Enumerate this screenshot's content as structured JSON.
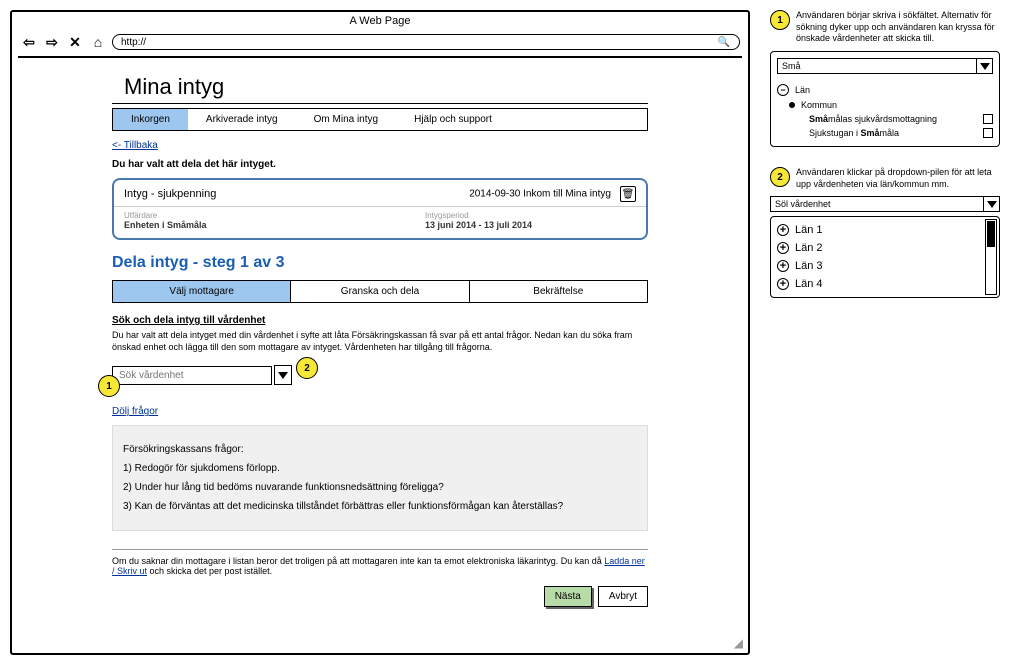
{
  "browser": {
    "title": "A Web Page",
    "url": "http://"
  },
  "page": {
    "title": "Mina intyg",
    "tabs": [
      "Inkorgen",
      "Arkiverade intyg",
      "Om Mina intyg",
      "Hjälp och support"
    ],
    "back_link": "<- Tillbaka",
    "intro": "Du har valt att dela det här intyget.",
    "cert": {
      "title": "Intyg - sjukpenning",
      "date": "2014-09-30 Inkom till Mina intyg",
      "issuer_label": "Utfärdare",
      "issuer_value": "Enheten i Småmåla",
      "period_label": "Intygsperiod",
      "period_value": "13 juni 2014 - 13 juli 2014"
    },
    "step_title": "Dela intyg - steg 1 av 3",
    "steps": [
      "Välj mottagare",
      "Granska och dela",
      "Bekräftelse"
    ],
    "search_section": {
      "title": "Sök och dela intyg till vårdenhet",
      "desc": "Du har valt att dela intyget med din vårdenhet i syfte att låta Försäkringskassan få svar på ett antal frågor. Nedan kan du  söka fram önskad enhet och lägga till den som mottagare av intyget. Vårdenheten har tillgång till frågorna.",
      "placeholder": "Sök vårdenhet"
    },
    "hide_link": "Dölj frågor",
    "questions": {
      "title": "Försökringskassans frågor:",
      "q1": "1) Redogör för sjukdomens förlopp.",
      "q2": "2) Under hur lång tid bedöms nuvarande funktionsnedsättning föreligga?",
      "q3": "3) Kan de förväntas att det medicinska tillståndet förbättras eller funktionsförmågan kan återställas?"
    },
    "footer": {
      "text_before": "Om du saknar din mottagare i listan beror det troligen på att mottagaren inte kan ta emot elektroniska läkarintyg. Du kan då ",
      "link": "Ladda ner / Skriv ut",
      "text_after": " och skicka det per post istället."
    },
    "buttons": {
      "next": "Nästa",
      "cancel": "Avbryt"
    }
  },
  "anno1": {
    "num": "1",
    "text": "Användaren börjar skriva i sökfältet. Alternativ för sökning dyker upp och användaren kan kryssa för önskade vårdenheter att skicka till.",
    "search_value": "Små",
    "lan": "Län",
    "kommun": "Kommun",
    "item1_before": "Små",
    "item1_after": "målas sjukvårdsmottagning",
    "item2_before": "Sjukstugan i ",
    "item2_bold": "Små",
    "item2_after": "måla"
  },
  "anno2": {
    "num": "2",
    "text": "Användaren klickar på dropdown-pilen för att leta upp vårdenheten via län/kommun mm.",
    "placeholder": "Söl vårdenhet",
    "items": [
      "Län 1",
      "Län 2",
      "Län 3",
      "Län 4"
    ]
  }
}
